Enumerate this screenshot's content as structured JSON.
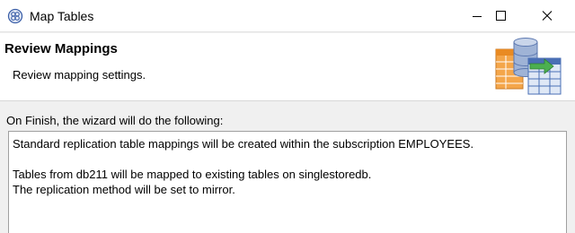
{
  "window": {
    "title": "Map Tables",
    "icon": "wizard-globe-icon",
    "controls": [
      "minimize-icon",
      "maximize-icon",
      "close-icon"
    ]
  },
  "header": {
    "title": "Review Mappings",
    "subtitle": "Review mapping settings.",
    "graphic": "database-tables-mapping-icon"
  },
  "summary": {
    "label": "On Finish, the wizard will do the following:",
    "lines": [
      "Standard replication table mappings will be created within the subscription EMPLOYEES.",
      "Tables from db211 will be mapped to existing tables on singlestoredb.",
      "The replication method will be set to mirror."
    ]
  },
  "colors": {
    "icon_blue": "#3b5fa8",
    "header_bg": "#ffffff",
    "body_bg": "#f0f0f0",
    "border": "#a0a0a0"
  }
}
